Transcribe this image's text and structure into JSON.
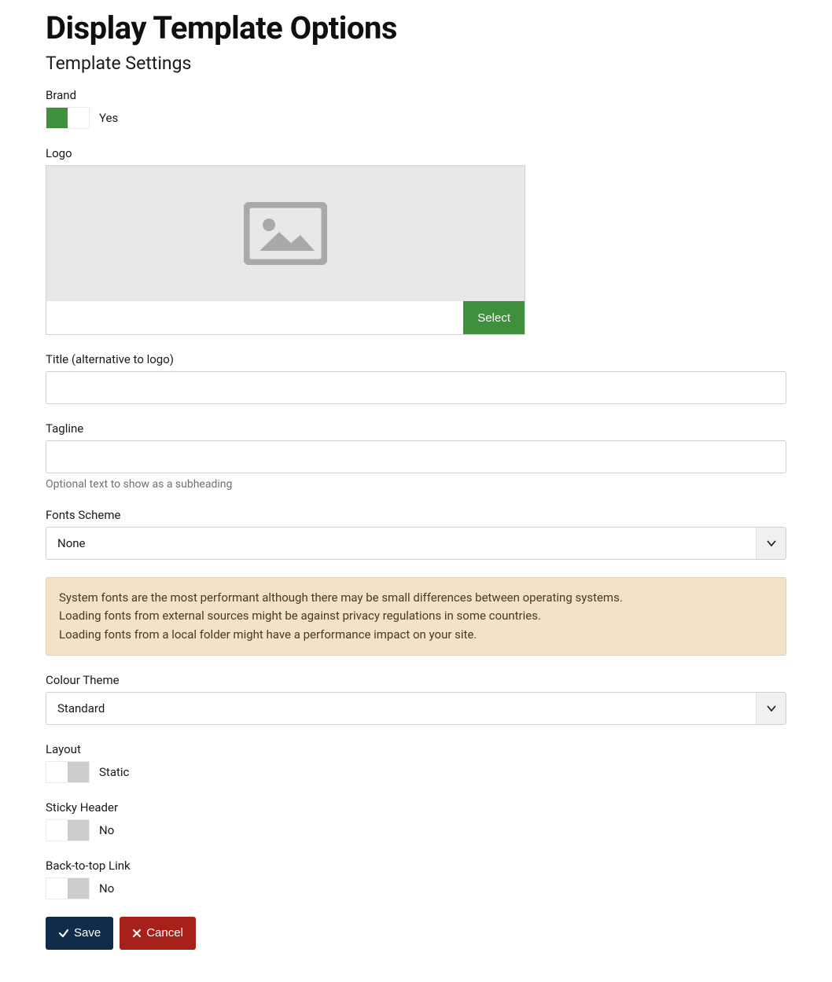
{
  "page": {
    "title": "Display Template Options",
    "subtitle": "Template Settings"
  },
  "brand": {
    "label": "Brand",
    "state_label": "Yes",
    "on": true
  },
  "logo": {
    "label": "Logo",
    "value": "",
    "select_label": "Select"
  },
  "title_field": {
    "label": "Title (alternative to logo)",
    "value": ""
  },
  "tagline": {
    "label": "Tagline",
    "value": "",
    "help": "Optional text to show as a subheading"
  },
  "fonts": {
    "label": "Fonts Scheme",
    "value": "None"
  },
  "fonts_alert": {
    "line1": "System fonts are the most performant although there may be small differences between operating systems.",
    "line2": "Loading fonts from external sources might be against privacy regulations in some countries.",
    "line3": "Loading fonts from a local folder might have a performance impact on your site."
  },
  "colour": {
    "label": "Colour Theme",
    "value": "Standard"
  },
  "layout": {
    "label": "Layout",
    "state_label": "Static",
    "on": false
  },
  "sticky": {
    "label": "Sticky Header",
    "state_label": "No",
    "on": false
  },
  "backtotop": {
    "label": "Back-to-top Link",
    "state_label": "No",
    "on": false
  },
  "actions": {
    "save": "Save",
    "cancel": "Cancel"
  },
  "colors": {
    "green": "#3f8f3f",
    "navy": "#112b4a",
    "red": "#a72019",
    "alert_bg": "#f3e2c7"
  }
}
